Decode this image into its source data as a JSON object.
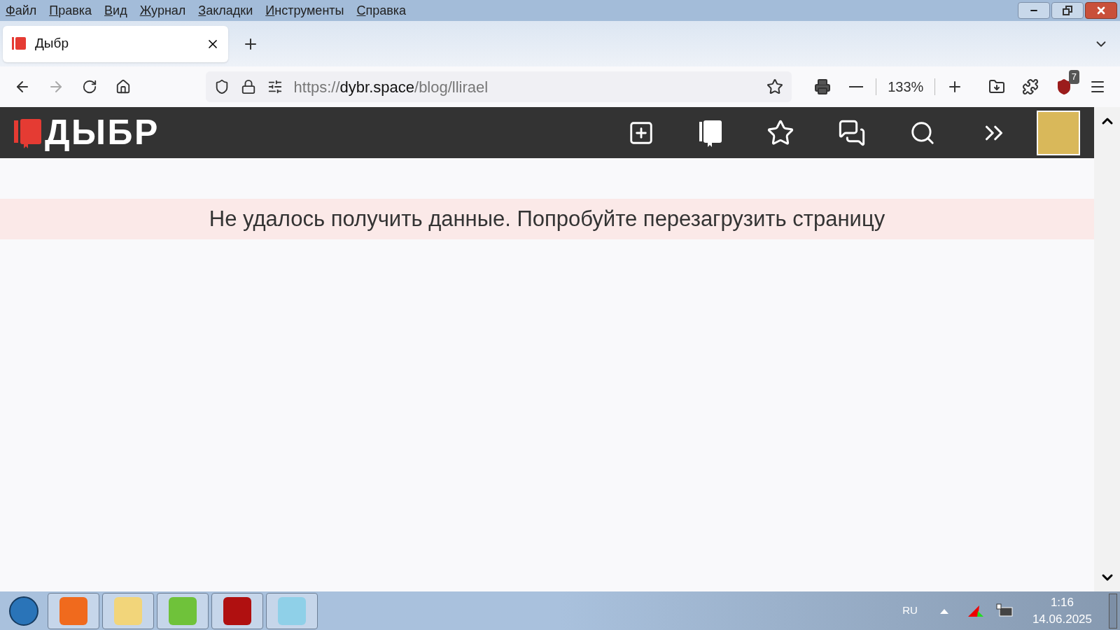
{
  "menu_bar": [
    "Файл",
    "Правка",
    "Вид",
    "Журнал",
    "Закладки",
    "Инструменты",
    "Справка"
  ],
  "tabs": [
    {
      "title": "Дыбр",
      "selected": true
    }
  ],
  "address_bar": {
    "scheme": "https://",
    "host": "dybr.space",
    "path": "/blog/llirael"
  },
  "zoom": "133%",
  "extension_badge": "7",
  "site": {
    "logo": "ДЫБР"
  },
  "error_message": "Не удалось получить данные. Попробуйте перезагрузить страницу",
  "taskbar": {
    "language": "RU",
    "time": "1:16",
    "date": "14.06.2025"
  }
}
